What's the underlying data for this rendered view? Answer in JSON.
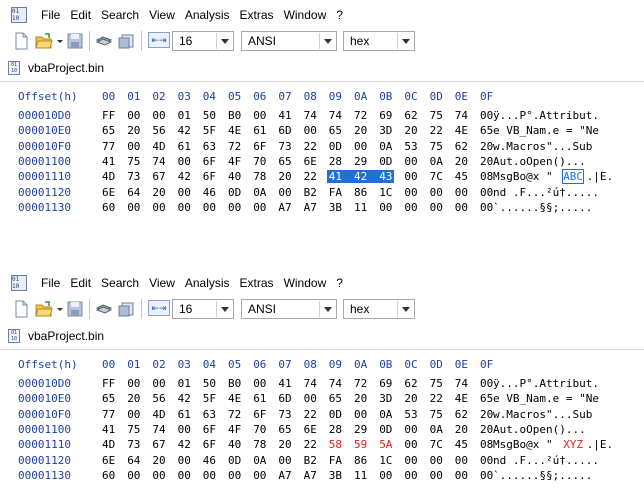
{
  "app_icon_text": "01\n10",
  "menu": [
    "File",
    "Edit",
    "Search",
    "View",
    "Analysis",
    "Extras",
    "Window",
    "?"
  ],
  "toolbar": {
    "bytes_per_row": "16",
    "encoding": "ANSI",
    "display_mode": "hex"
  },
  "tab": {
    "label": "vbaProject.bin"
  },
  "hex_header": {
    "offset_label": "Offset(h)",
    "columns": [
      "00",
      "01",
      "02",
      "03",
      "04",
      "05",
      "06",
      "07",
      "08",
      "09",
      "0A",
      "0B",
      "0C",
      "0D",
      "0E",
      "0F"
    ]
  },
  "panels": [
    {
      "rows": [
        {
          "offset": "000010D0",
          "bytes": [
            "FF",
            "00",
            "00",
            "01",
            "50",
            "B0",
            "00",
            "41",
            "74",
            "74",
            "72",
            "69",
            "62",
            "75",
            "74",
            "00"
          ],
          "ascii": "ÿ...P°.Attribut."
        },
        {
          "offset": "000010E0",
          "bytes": [
            "65",
            "20",
            "56",
            "42",
            "5F",
            "4E",
            "61",
            "6D",
            "00",
            "65",
            "20",
            "3D",
            "20",
            "22",
            "4E",
            "65"
          ],
          "ascii": "e VB_Nam.e = \"Ne"
        },
        {
          "offset": "000010F0",
          "bytes": [
            "77",
            "00",
            "4D",
            "61",
            "63",
            "72",
            "6F",
            "73",
            "22",
            "0D",
            "00",
            "0A",
            "53",
            "75",
            "62",
            "20"
          ],
          "ascii": "w.Macros\"...Sub "
        },
        {
          "offset": "00001100",
          "bytes": [
            "41",
            "75",
            "74",
            "00",
            "6F",
            "4F",
            "70",
            "65",
            "6E",
            "28",
            "29",
            "0D",
            "00",
            "0A",
            "20",
            "20"
          ],
          "ascii": "Aut.oOpen()...  "
        },
        {
          "offset": "00001110",
          "bytes": [
            "4D",
            "73",
            "67",
            "42",
            "6F",
            "40",
            "78",
            "20",
            "22",
            "41",
            "42",
            "43",
            "00",
            "7C",
            "45",
            "08"
          ],
          "ascii": "MsgBo@x \"ABC.|E."
        },
        {
          "offset": "00001120",
          "bytes": [
            "6E",
            "64",
            "20",
            "00",
            "46",
            "0D",
            "0A",
            "00",
            "B2",
            "FA",
            "86",
            "1C",
            "00",
            "00",
            "00",
            "00"
          ],
          "ascii": "nd .F...²ú†....."
        },
        {
          "offset": "00001130",
          "bytes": [
            "60",
            "00",
            "00",
            "00",
            "00",
            "00",
            "00",
            "A7",
            "A7",
            "3B",
            "11",
            "00",
            "00",
            "00",
            "00",
            "00"
          ],
          "ascii": "`......§§;....."
        }
      ],
      "highlight": {
        "row": 4,
        "bytes": [
          9,
          10,
          11
        ],
        "ascii_start": 9,
        "ascii_len": 3,
        "style": "selected"
      }
    },
    {
      "rows": [
        {
          "offset": "000010D0",
          "bytes": [
            "FF",
            "00",
            "00",
            "01",
            "50",
            "B0",
            "00",
            "41",
            "74",
            "74",
            "72",
            "69",
            "62",
            "75",
            "74",
            "00"
          ],
          "ascii": "ÿ...P°.Attribut."
        },
        {
          "offset": "000010E0",
          "bytes": [
            "65",
            "20",
            "56",
            "42",
            "5F",
            "4E",
            "61",
            "6D",
            "00",
            "65",
            "20",
            "3D",
            "20",
            "22",
            "4E",
            "65"
          ],
          "ascii": "e VB_Nam.e = \"Ne"
        },
        {
          "offset": "000010F0",
          "bytes": [
            "77",
            "00",
            "4D",
            "61",
            "63",
            "72",
            "6F",
            "73",
            "22",
            "0D",
            "00",
            "0A",
            "53",
            "75",
            "62",
            "20"
          ],
          "ascii": "w.Macros\"...Sub "
        },
        {
          "offset": "00001100",
          "bytes": [
            "41",
            "75",
            "74",
            "00",
            "6F",
            "4F",
            "70",
            "65",
            "6E",
            "28",
            "29",
            "0D",
            "00",
            "0A",
            "20",
            "20"
          ],
          "ascii": "Aut.oOpen()...  "
        },
        {
          "offset": "00001110",
          "bytes": [
            "4D",
            "73",
            "67",
            "42",
            "6F",
            "40",
            "78",
            "20",
            "22",
            "58",
            "59",
            "5A",
            "00",
            "7C",
            "45",
            "08"
          ],
          "ascii": "MsgBo@x \"XYZ.|E."
        },
        {
          "offset": "00001120",
          "bytes": [
            "6E",
            "64",
            "20",
            "00",
            "46",
            "0D",
            "0A",
            "00",
            "B2",
            "FA",
            "86",
            "1C",
            "00",
            "00",
            "00",
            "00"
          ],
          "ascii": "nd .F...²ú†....."
        },
        {
          "offset": "00001130",
          "bytes": [
            "60",
            "00",
            "00",
            "00",
            "00",
            "00",
            "00",
            "A7",
            "A7",
            "3B",
            "11",
            "00",
            "00",
            "00",
            "00",
            "00"
          ],
          "ascii": "`......§§;....."
        }
      ],
      "highlight": {
        "row": 4,
        "bytes": [
          9,
          10,
          11
        ],
        "ascii_start": 9,
        "ascii_len": 3,
        "style": "modified"
      }
    }
  ],
  "colors": {
    "offset_blue": "#1e3fa0",
    "selection": "#1f6fd8",
    "modified_red": "#e02020"
  },
  "icons": [
    "new-file-icon",
    "open-folder-icon",
    "save-icon",
    "cut-icon",
    "copy-icon",
    "bytes-per-row-icon"
  ]
}
